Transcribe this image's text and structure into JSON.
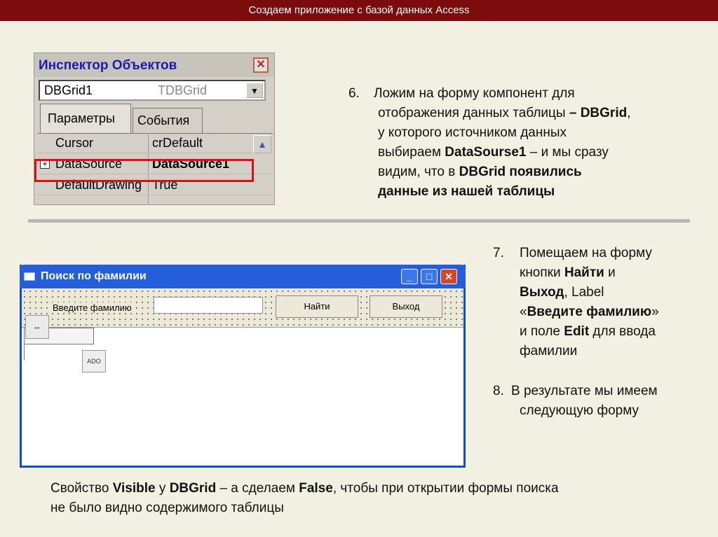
{
  "header": {
    "title": "Создаем приложение с базой данных Access"
  },
  "inspector": {
    "title": "Инспектор Объектов",
    "component_name": "DBGrid1",
    "component_type": "TDBGrid",
    "tabs": [
      "Параметры",
      "События"
    ],
    "properties": [
      {
        "key": "Cursor",
        "value": "crDefault"
      },
      {
        "key": "DataSource",
        "value": "DataSource1"
      },
      {
        "key": "DefaultDrawing",
        "value": "True"
      }
    ]
  },
  "step6": {
    "num": "6.",
    "line1": "Ложим на форму компонент для",
    "line2_a": "отображения данных таблицы ",
    "line2_b": "– DBGrid",
    "line2_c": ",",
    "line3": "у которого источником данных",
    "line4_a": "выбираем ",
    "line4_b": "DataSourse1",
    "line4_c": " – и мы сразу",
    "line5_a": "видим, что в ",
    "line5_b": "DBGrid появились",
    "line6": "данные из нашей таблицы"
  },
  "search_form": {
    "title": "Поиск по фамилии",
    "label": "Введите фамилию",
    "find_button": "Найти",
    "exit_button": "Выход"
  },
  "step7": {
    "num": "7.",
    "line1": "Помещаем на форму",
    "line2_a": "кнопки ",
    "line2_b": "Найти",
    "line2_c": " и",
    "line3_a": "Выход",
    "line3_b": ", Label",
    "line4_a": "«",
    "line4_b": "Введите фамилию",
    "line4_c": "»",
    "line5_a": "и поле ",
    "line5_b": "Edit",
    "line5_c": " для ввода",
    "line6": "фамилии"
  },
  "step8": {
    "num": "8.",
    "line1": "В результате мы имеем",
    "line2": "следующую форму"
  },
  "bottom": {
    "a": "Свойство ",
    "b": "Visible",
    "c": " у ",
    "d": "DBGrid",
    "e": " – а сделаем ",
    "f": "False",
    "g": ", чтобы при открытии формы поиска",
    "line2": "не было видно содержимого таблицы"
  }
}
